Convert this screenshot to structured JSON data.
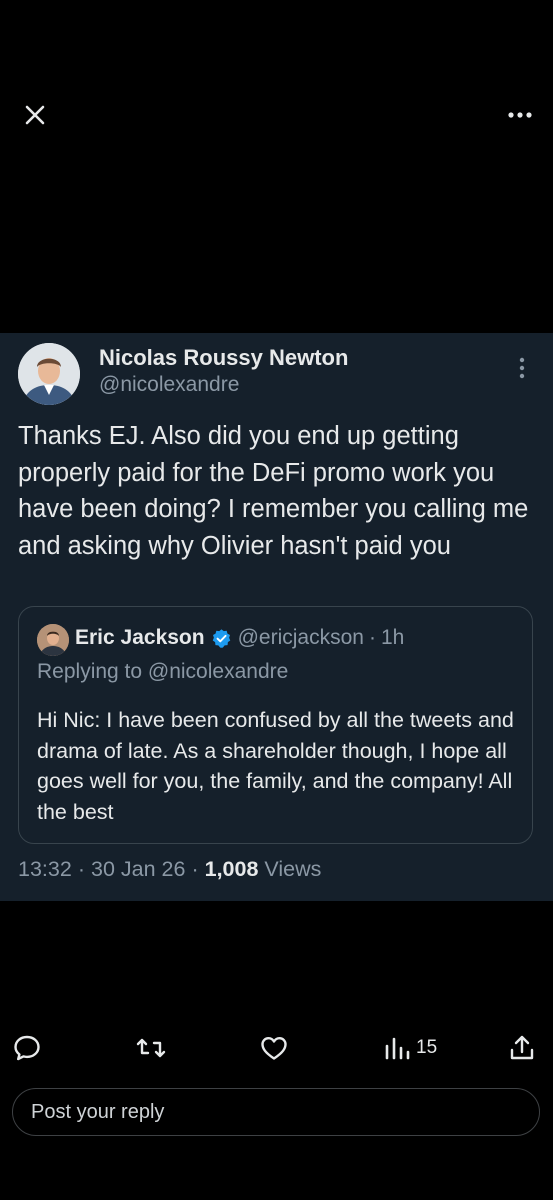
{
  "topbar": {
    "close_icon": "close-icon",
    "more_icon": "more-horizontal-icon"
  },
  "tweet": {
    "author_name": "Nicolas Roussy Newton",
    "author_handle": "@nicolexandre",
    "text": "Thanks EJ. Also did you end up getting properly paid for the DeFi promo work you have been doing? I remember you calling me and asking why Olivier hasn't paid you",
    "quote": {
      "author_name": "Eric Jackson",
      "author_handle": "@ericjackson",
      "separator": "·",
      "time": "1h",
      "replying_to": "Replying to @nicolexandre",
      "text": "Hi Nic: I have been confused by all the tweets and drama of late. As a shareholder though, I hope all goes well for you, the family, and the company! All the best"
    },
    "time": "13:32",
    "date": "30 Jan 26",
    "views_count": "1,008",
    "views_label": "Views",
    "dot": "·"
  },
  "actions": {
    "views_count": "15"
  },
  "reply": {
    "placeholder": "Post your reply"
  },
  "colors": {
    "background": "#000000",
    "card": "#15202b",
    "text_primary": "#e7e9ea",
    "text_secondary": "#8b98a5",
    "verified": "#1d9bf0",
    "border": "#38444d"
  }
}
